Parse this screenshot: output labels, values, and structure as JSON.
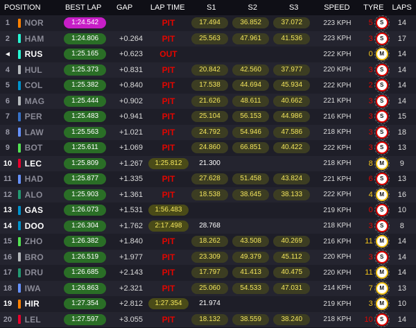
{
  "headers": {
    "position": "POSITION",
    "best_lap": "BEST LAP",
    "gap": "GAP",
    "lap_time": "LAP TIME",
    "s1": "S1",
    "s2": "S2",
    "s3": "S3",
    "speed": "SPEED",
    "tyre": "TYRE",
    "laps": "LAPS"
  },
  "rows": [
    {
      "pos": "1",
      "name": "NOR",
      "team": "#ff8000",
      "best": "1:24.542",
      "best_fastest": true,
      "gap": "",
      "lap": "PIT",
      "s1": "17.494",
      "s2": "36.852",
      "s3": "37.072",
      "speed": "223 KPH",
      "age": "5",
      "age_color": "#e10600",
      "tyre": "S",
      "laps": "14"
    },
    {
      "pos": "2",
      "name": "HAM",
      "team": "#27f4d2",
      "best": "1:24.806",
      "gap": "+0.264",
      "lap": "PIT",
      "s1": "25.563",
      "s2": "47.961",
      "s3": "41.536",
      "speed": "223 KPH",
      "age": "3",
      "age_color": "#e10600",
      "tyre": "S",
      "laps": "17"
    },
    {
      "pos": "◄",
      "pos_out": true,
      "name": "RUS",
      "active": true,
      "team": "#27f4d2",
      "best": "1:25.165",
      "gap": "+0.623",
      "lap": "OUT",
      "s1": "",
      "s2": "",
      "s3": "",
      "speed": "222 KPH",
      "age": "0",
      "age_color": "#f5c518",
      "tyre": "M",
      "laps": "14"
    },
    {
      "pos": "4",
      "name": "HUL",
      "team": "#b6babd",
      "best": "1:25.373",
      "gap": "+0.831",
      "lap": "PIT",
      "s1": "20.842",
      "s2": "42.560",
      "s3": "37.977",
      "speed": "220 KPH",
      "age": "3",
      "age_color": "#e10600",
      "tyre": "S",
      "laps": "14"
    },
    {
      "pos": "5",
      "name": "COL",
      "team": "#0093cc",
      "best": "1:25.382",
      "gap": "+0.840",
      "lap": "PIT",
      "s1": "17.538",
      "s2": "44.694",
      "s3": "45.934",
      "speed": "222 KPH",
      "age": "2",
      "age_color": "#e10600",
      "tyre": "S",
      "laps": "14"
    },
    {
      "pos": "6",
      "name": "MAG",
      "team": "#b6babd",
      "best": "1:25.444",
      "gap": "+0.902",
      "lap": "PIT",
      "s1": "21.626",
      "s2": "48.611",
      "s3": "40.662",
      "speed": "221 KPH",
      "age": "3",
      "age_color": "#e10600",
      "tyre": "S",
      "laps": "14"
    },
    {
      "pos": "7",
      "name": "PER",
      "team": "#3671c6",
      "best": "1:25.483",
      "gap": "+0.941",
      "lap": "PIT",
      "s1": "25.104",
      "s2": "56.153",
      "s3": "44.986",
      "speed": "216 KPH",
      "age": "3",
      "age_color": "#e10600",
      "tyre": "S",
      "laps": "15"
    },
    {
      "pos": "8",
      "name": "LAW",
      "team": "#6692ff",
      "best": "1:25.563",
      "gap": "+1.021",
      "lap": "PIT",
      "s1": "24.792",
      "s2": "54.946",
      "s3": "47.586",
      "speed": "218 KPH",
      "age": "3",
      "age_color": "#e10600",
      "tyre": "S",
      "laps": "18"
    },
    {
      "pos": "9",
      "name": "BOT",
      "team": "#52e252",
      "best": "1:25.611",
      "gap": "+1.069",
      "lap": "PIT",
      "s1": "24.860",
      "s2": "66.851",
      "s3": "40.422",
      "speed": "222 KPH",
      "age": "3",
      "age_color": "#e10600",
      "tyre": "S",
      "laps": "13"
    },
    {
      "pos": "10",
      "name": "LEC",
      "active": true,
      "team": "#e8002d",
      "best": "1:25.809",
      "gap": "+1.267",
      "lap": "1:25.812",
      "s1": "21.300",
      "s1_plain": true,
      "s2": "",
      "s3": "",
      "speed": "218 KPH",
      "age": "8",
      "age_color": "#f5c518",
      "tyre": "M",
      "laps": "9"
    },
    {
      "pos": "11",
      "name": "HAD",
      "team": "#6692ff",
      "best": "1:25.877",
      "gap": "+1.335",
      "lap": "PIT",
      "s1": "27.628",
      "s2": "51.458",
      "s3": "43.824",
      "speed": "221 KPH",
      "age": "6",
      "age_color": "#e10600",
      "tyre": "S",
      "laps": "13"
    },
    {
      "pos": "12",
      "name": "ALO",
      "team": "#229971",
      "best": "1:25.903",
      "gap": "+1.361",
      "lap": "PIT",
      "s1": "18.538",
      "s2": "38.645",
      "s3": "38.133",
      "speed": "222 KPH",
      "age": "4",
      "age_color": "#f5c518",
      "tyre": "M",
      "laps": "16"
    },
    {
      "pos": "13",
      "name": "GAS",
      "active": true,
      "team": "#0093cc",
      "best": "1:26.073",
      "gap": "+1.531",
      "lap": "1:56.483",
      "s1": "",
      "s2": "",
      "s3": "",
      "speed": "219 KPH",
      "age": "0",
      "age_color": "#e10600",
      "tyre": "S",
      "laps": "10"
    },
    {
      "pos": "14",
      "name": "DOO",
      "active": true,
      "team": "#0093cc",
      "best": "1:26.304",
      "gap": "+1.762",
      "lap": "2:17.498",
      "s1": "28.768",
      "s1_plain": true,
      "s2": "",
      "s3": "",
      "speed": "218 KPH",
      "age": "3",
      "age_color": "#e10600",
      "tyre": "S",
      "laps": "8"
    },
    {
      "pos": "15",
      "name": "ZHO",
      "team": "#52e252",
      "best": "1:26.382",
      "gap": "+1.840",
      "lap": "PIT",
      "s1": "18.262",
      "s2": "43.508",
      "s3": "40.269",
      "speed": "216 KPH",
      "age": "11",
      "age_color": "#f5c518",
      "tyre": "M",
      "laps": "14"
    },
    {
      "pos": "16",
      "name": "BRO",
      "team": "#b6babd",
      "best": "1:26.519",
      "gap": "+1.977",
      "lap": "PIT",
      "s1": "23.309",
      "s2": "49.379",
      "s3": "45.112",
      "speed": "220 KPH",
      "age": "3",
      "age_color": "#e10600",
      "tyre": "S",
      "laps": "14"
    },
    {
      "pos": "17",
      "name": "DRU",
      "team": "#229971",
      "best": "1:26.685",
      "gap": "+2.143",
      "lap": "PIT",
      "s1": "17.797",
      "s2": "41.413",
      "s3": "40.475",
      "speed": "220 KPH",
      "age": "11",
      "age_color": "#f5c518",
      "tyre": "M",
      "laps": "14"
    },
    {
      "pos": "18",
      "name": "IWA",
      "team": "#6692ff",
      "best": "1:26.863",
      "gap": "+2.321",
      "lap": "PIT",
      "s1": "25.060",
      "s2": "54.533",
      "s3": "47.031",
      "speed": "214 KPH",
      "age": "7",
      "age_color": "#f5c518",
      "tyre": "M",
      "laps": "13"
    },
    {
      "pos": "19",
      "name": "HIR",
      "active": true,
      "team": "#ff8000",
      "best": "1:27.354",
      "gap": "+2.812",
      "lap": "1:27.354",
      "s1": "21.974",
      "s1_plain": true,
      "s2": "",
      "s3": "",
      "speed": "219 KPH",
      "age": "3",
      "age_color": "#f5c518",
      "tyre": "M",
      "laps": "10"
    },
    {
      "pos": "20",
      "name": "LEL",
      "team": "#e8002d",
      "best": "1:27.597",
      "gap": "+3.055",
      "lap": "PIT",
      "s1": "18.132",
      "s2": "38.559",
      "s3": "38.240",
      "speed": "218 KPH",
      "age": "10",
      "age_color": "#e10600",
      "tyre": "S",
      "laps": "14"
    }
  ]
}
